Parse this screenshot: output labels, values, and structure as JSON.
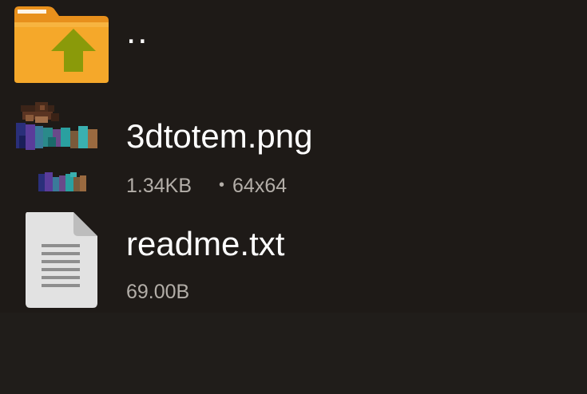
{
  "files": [
    {
      "name": "..",
      "icon": "folder-up-icon",
      "kind": "parent"
    },
    {
      "name": "3dtotem.png",
      "icon": "image-thumbnail",
      "size": "1.34KB",
      "separator": "•",
      "dimensions": "64x64"
    },
    {
      "name": "readme.txt",
      "icon": "document-icon",
      "size": "69.00B"
    }
  ],
  "colors": {
    "background": "#1e1a17",
    "empty_area": "#201d1a",
    "name_text": "#ffffff",
    "meta_text": "#b3aea8",
    "folder": "#f5a82a",
    "folder_arrow": "#8a9a0a"
  }
}
